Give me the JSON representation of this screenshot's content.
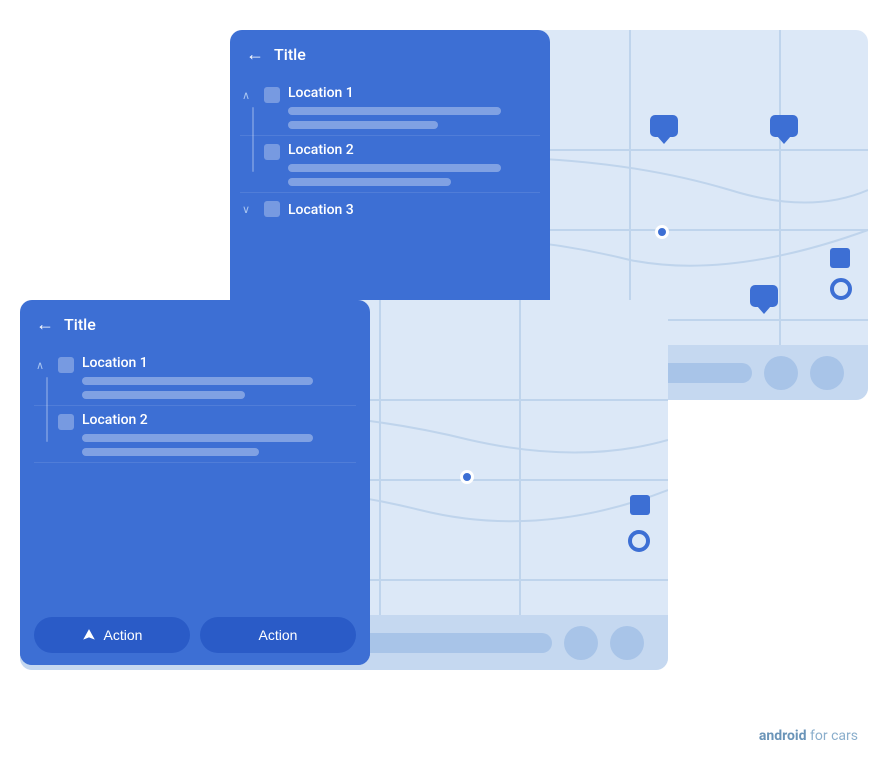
{
  "back_panel": {
    "title": "Title",
    "locations": [
      {
        "name": "Location 1",
        "expanded": true,
        "sub_bars": [
          "long",
          "medium"
        ]
      },
      {
        "name": "Location 2",
        "expanded": false,
        "sub_bars": [
          "long",
          "short"
        ]
      },
      {
        "name": "Location 3",
        "expanded": false,
        "sub_bars": []
      }
    ]
  },
  "front_panel": {
    "title": "Title",
    "locations": [
      {
        "name": "Location 1",
        "expanded": true,
        "sub_bars": [
          "long",
          "medium"
        ]
      },
      {
        "name": "Location 2",
        "expanded": false,
        "sub_bars": [
          "long",
          "short"
        ]
      }
    ],
    "actions": [
      {
        "label": "Action",
        "has_icon": true
      },
      {
        "label": "Action",
        "has_icon": false
      }
    ]
  },
  "brand": {
    "prefix": "android",
    "suffix": " for cars"
  },
  "colors": {
    "card_bg": "#3d6fd4",
    "map_bg": "#dce8f7",
    "nav_bg": "#c5d8f0",
    "accent": "#3d6fd4"
  }
}
